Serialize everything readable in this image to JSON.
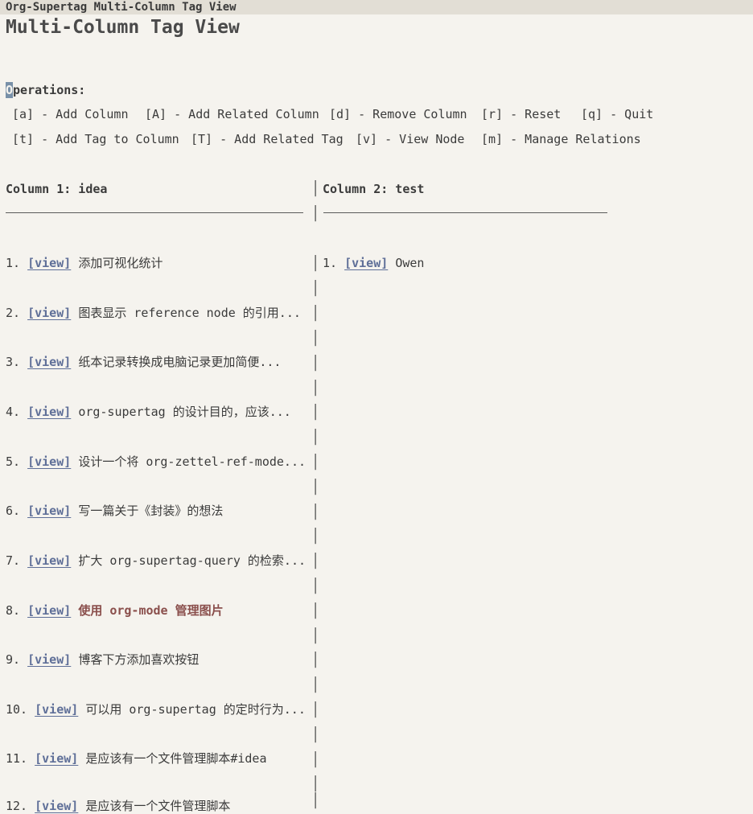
{
  "window": {
    "title": "Org-Supertag Multi-Column Tag View"
  },
  "heading": "Multi-Column Tag View",
  "operations": {
    "label_first": "O",
    "label_rest": "perations:",
    "row1": [
      "[a] - Add Column",
      "[A] - Add Related Column",
      "[d] - Remove Column",
      "[r] - Reset",
      "[q] - Quit"
    ],
    "row2": [
      "[t] - Add Tag to Column",
      "[T] - Add Related Tag",
      "[v] - View Node",
      "[m] - Manage Relations"
    ]
  },
  "columns": [
    {
      "header": "Column 1: idea",
      "items": [
        {
          "num": "1.",
          "link": "[view]",
          "text": "添加可视化统计"
        },
        {
          "num": "2.",
          "link": "[view]",
          "text": "图表显示 reference node 的引用..."
        },
        {
          "num": "3.",
          "link": "[view]",
          "text": "纸本记录转换成电脑记录更加简便..."
        },
        {
          "num": "4.",
          "link": "[view]",
          "text": "org-supertag 的设计目的，应该..."
        },
        {
          "num": "5.",
          "link": "[view]",
          "text": "设计一个将 org-zettel-ref-mode..."
        },
        {
          "num": "6.",
          "link": "[view]",
          "text": "写一篇关于《封装》的想法"
        },
        {
          "num": "7.",
          "link": "[view]",
          "text": "扩大 org-supertag-query 的检索..."
        },
        {
          "num": "8.",
          "link": "[view]",
          "text": "使用 org-mode 管理图片"
        },
        {
          "num": "9.",
          "link": "[view]",
          "text": "博客下方添加喜欢按钮"
        },
        {
          "num": "10.",
          "link": "[view]",
          "text": "可以用 org-supertag 的定时行为..."
        },
        {
          "num": "11.",
          "link": "[view]",
          "text": "是应该有一个文件管理脚本#idea"
        },
        {
          "num": "12.",
          "link": "[view]",
          "text": "是应该有一个文件管理脚本"
        }
      ]
    },
    {
      "header": "Column 2: test",
      "items": [
        {
          "num": "1.",
          "link": "[view]",
          "text": "Owen"
        }
      ]
    }
  ],
  "separator_glyph": "│",
  "colors": {
    "link": "#5f6f98",
    "highlight": "#8a4f4c",
    "background": "#f5f3ee"
  }
}
